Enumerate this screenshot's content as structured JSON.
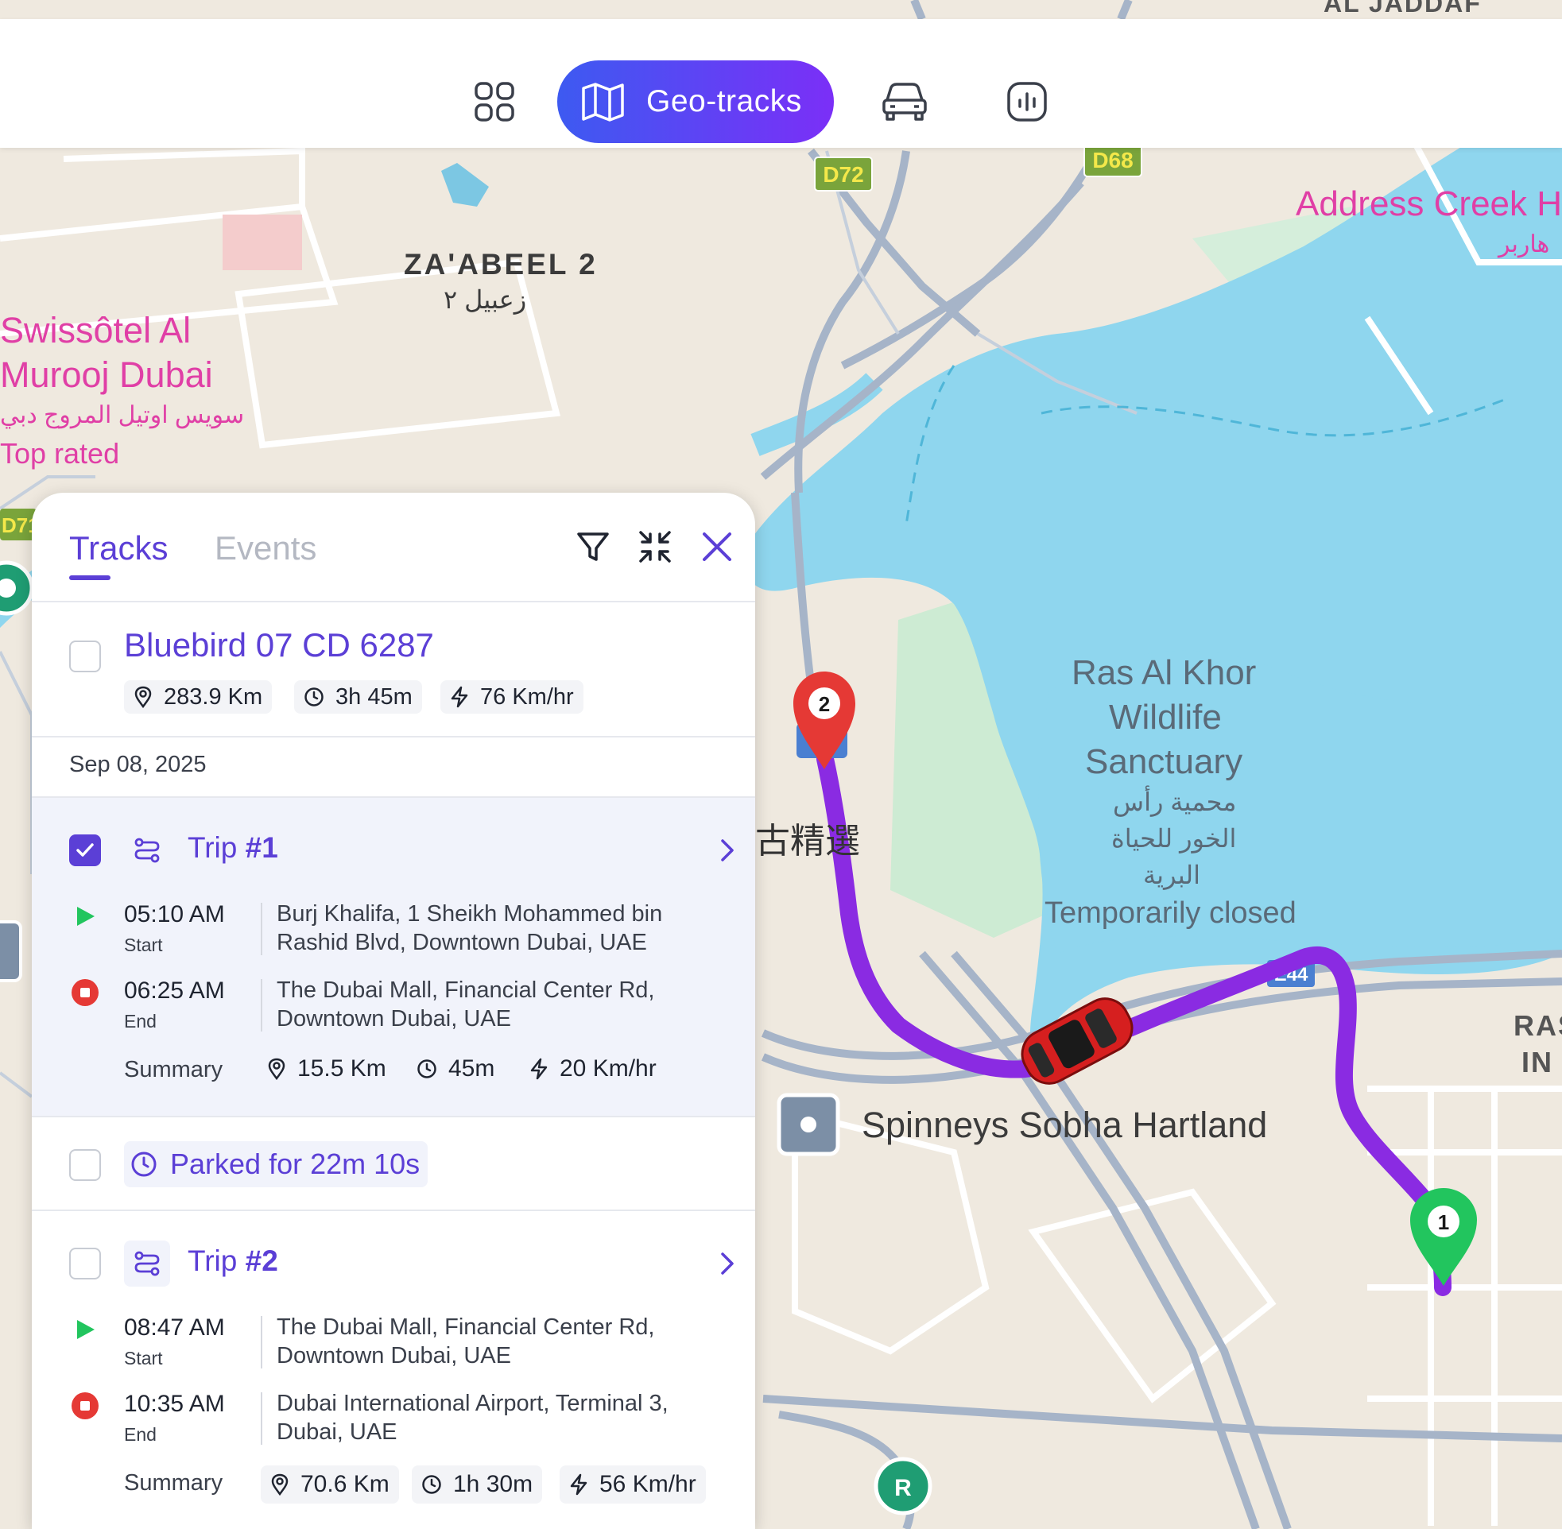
{
  "nav": {
    "items": [
      {
        "id": "dashboard",
        "icon": "grid-icon"
      },
      {
        "id": "geo-tracks",
        "icon": "map-icon",
        "label": "Geo-tracks",
        "active": true
      },
      {
        "id": "vehicles",
        "icon": "car-icon"
      },
      {
        "id": "reports",
        "icon": "bar-chart-icon"
      }
    ],
    "gradient_start": "#3d5af1",
    "gradient_end": "#7b2ff7"
  },
  "map": {
    "labels": {
      "top_area": "AL JADDAF",
      "zaabeel": "ZA'ABEEL 2",
      "zaabeel_ar": "زعبيل ٢",
      "hotel_name_1": "Swissôtel Al",
      "hotel_name_2": "Murooj Dubai",
      "hotel_ar": "سويس اوتيل المروج دبي",
      "hotel_note": "Top rated",
      "address_creek": "Address Creek H",
      "address_creek_ar": "هاربر",
      "sanctuary_1": "Ras Al Khor",
      "sanctuary_2": "Wildlife",
      "sanctuary_3": "Sanctuary",
      "sanctuary_ar_1": "محمية رأس",
      "sanctuary_ar_2": "الخور للحياة",
      "sanctuary_ar_3": "البرية",
      "sanctuary_status": "Temporarily closed",
      "cjk": "古精選",
      "store": "Spinneys Sobha Hartland",
      "ras_1": "RAS",
      "ras_2": "IN",
      "road_d72": "D72",
      "road_d68": "D68",
      "road_d71": "D71",
      "road_e44": "E44"
    },
    "markers": {
      "start": "1",
      "end": "2"
    },
    "colors": {
      "route": "#8a2be2",
      "start_pin": "#22c55e",
      "end_pin": "#e53935",
      "water": "#8fd6ee",
      "land": "#efe9df"
    }
  },
  "panel": {
    "tabs": {
      "tracks": "Tracks",
      "events": "Events"
    },
    "vehicle": {
      "name": "Bluebird 07 CD 6287",
      "distance": "283.9 Km",
      "duration": "3h 45m",
      "speed": "76 Km/hr"
    },
    "date": "Sep 08, 2025",
    "trip1": {
      "prefix": "Trip ",
      "number": "#1",
      "checked": true,
      "start_time": "05:10 AM",
      "start_label": "Start",
      "start_addr_1": "Burj Khalifa, 1 Sheikh Mohammed bin",
      "start_addr_2": "Rashid Blvd, Downtown Dubai, UAE",
      "end_time": "06:25 AM",
      "end_label": "End",
      "end_addr_1": "The Dubai Mall, Financial Center Rd,",
      "end_addr_2": "Downtown Dubai, UAE",
      "summary_label": "Summary",
      "distance": "15.5 Km",
      "duration": "45m",
      "speed": "20 Km/hr"
    },
    "parked": {
      "text": "Parked for 22m 10s",
      "checked": false
    },
    "trip2": {
      "prefix": "Trip ",
      "number": "#2",
      "checked": false,
      "start_time": "08:47 AM",
      "start_label": "Start",
      "start_addr_1": "The Dubai Mall, Financial Center Rd,",
      "start_addr_2": "Downtown Dubai, UAE",
      "end_time": "10:35 AM",
      "end_label": "End",
      "end_addr_1": "Dubai International Airport, Terminal 3,",
      "end_addr_2": "Dubai, UAE",
      "summary_label": "Summary",
      "distance": "70.6 Km",
      "duration": "1h 30m",
      "speed": "56 Km/hr"
    },
    "accent": "#5b3fd6"
  }
}
